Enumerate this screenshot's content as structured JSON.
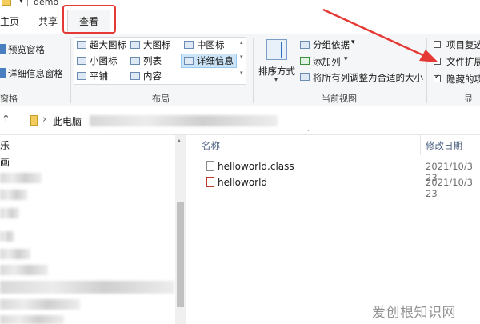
{
  "window": {
    "title": "demo",
    "qat_arrow": "▾"
  },
  "tabs": [
    {
      "label": "主页"
    },
    {
      "label": "共享"
    },
    {
      "label": "查看"
    }
  ],
  "ribbon": {
    "panes": {
      "label": "窗格",
      "preview": "预览窗格",
      "details": "详细信息窗格"
    },
    "layout": {
      "label": "布局",
      "options": [
        "超大图标",
        "大图标",
        "中图标",
        "小图标",
        "列表",
        "详细信息",
        "平铺",
        "内容"
      ],
      "selected": "详细信息"
    },
    "current_view": {
      "label": "当前视图",
      "sort": "排序方式",
      "group_by": "分组依据",
      "add_column": "添加列",
      "fit_columns": "将所有列调整为合适的大小"
    },
    "show_hide": {
      "label": "显示",
      "item_checkboxes": "项目复选",
      "file_extensions": "文件扩展",
      "hidden_items": "隐藏的项",
      "item_checkboxes_checked": false,
      "file_extensions_checked": false,
      "hidden_items_checked": true
    }
  },
  "address": {
    "crumb1": "此电脑",
    "sep": "›"
  },
  "nav": {
    "items": [
      "乐",
      "画"
    ]
  },
  "columns": {
    "name": "名称",
    "modified": "修改日期"
  },
  "files": [
    {
      "name": "helloworld.class",
      "modified": "2021/10/3 23"
    },
    {
      "name": "helloworld",
      "modified": "2021/10/3 23"
    }
  ],
  "watermark": "爱创根知识网",
  "colors": {
    "highlight_red": "#e53935",
    "selection_blue": "#cce4f7",
    "ribbon_bg": "#f5f6f7"
  }
}
